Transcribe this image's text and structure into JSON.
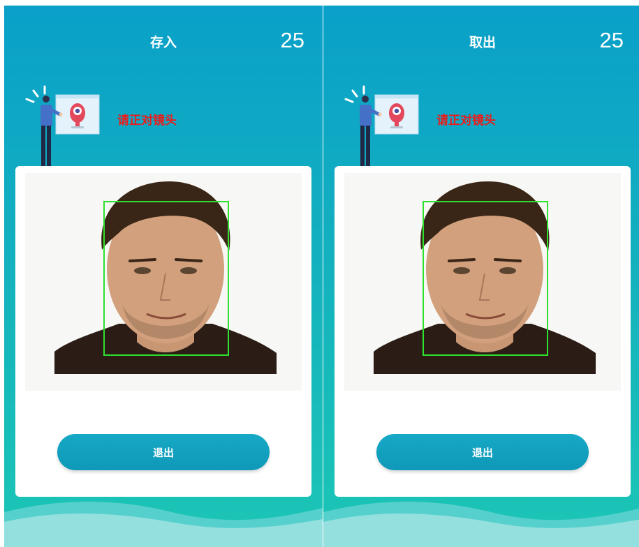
{
  "panels": [
    {
      "title": "存入",
      "counter": "25",
      "hint": "请正对镜头",
      "exit_label": "退出"
    },
    {
      "title": "取出",
      "counter": "25",
      "hint": "请正对镜头",
      "exit_label": "退出"
    }
  ],
  "colors": {
    "background_top": "#0aa0c9",
    "background_bottom": "#1cc6b5",
    "hint_text": "#e81e1e",
    "face_box": "#2ee12e",
    "button": "#13a3c1"
  },
  "icons": [
    "person-presenting-icon",
    "camera-icon"
  ]
}
